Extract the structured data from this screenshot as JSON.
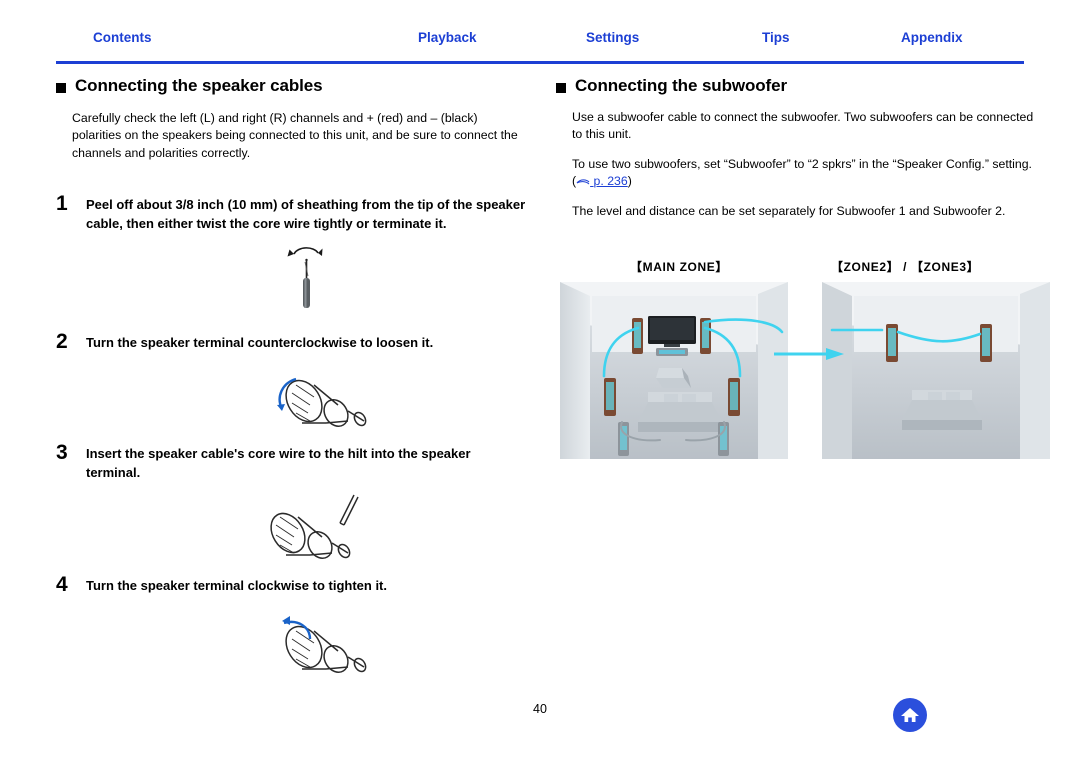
{
  "nav": {
    "items": [
      {
        "label": "Contents"
      },
      {
        "label": "Playback"
      },
      {
        "label": "Settings"
      },
      {
        "label": "Tips"
      },
      {
        "label": "Appendix"
      }
    ],
    "accent_color": "#1c3fd4"
  },
  "left": {
    "heading": "Connecting the speaker cables",
    "intro": "Carefully check the left (L) and right (R) channels and + (red) and – (black) polarities on the speakers being connected to this unit, and be sure to connect the channels and polarities correctly.",
    "steps": [
      {
        "number": "1",
        "text": "Peel off about 3/8 inch (10 mm) of sheathing from the tip of the speaker cable, then either twist the core wire tightly or terminate it.",
        "figure": "speaker-cable-twist-illustration"
      },
      {
        "number": "2",
        "text": "Turn the speaker terminal counterclockwise to loosen it.",
        "figure": "terminal-loosen-illustration"
      },
      {
        "number": "3",
        "text": "Insert the speaker cable's core wire to the hilt into the speaker terminal.",
        "figure": "insert-core-wire-illustration"
      },
      {
        "number": "4",
        "text": "Turn the speaker terminal clockwise to tighten it.",
        "figure": "terminal-tighten-illustration"
      }
    ]
  },
  "right": {
    "heading": "Connecting the subwoofer",
    "paragraph1": "Use a subwoofer cable to connect the subwoofer. Two subwoofers can be connected to this unit.",
    "paragraph2_before": "To use two subwoofers, set “Subwoofer” to “2 spkrs” in the “Speaker Config.” setting.  (",
    "paragraph2_link": "p. 236",
    "paragraph2_after": ")",
    "paragraph3": "The level and distance can be set separately for Subwoofer 1 and Subwoofer 2.",
    "zone_labels": {
      "main": "【MAIN ZONE】",
      "zone23": "【ZONE2】 / 【ZONE3】"
    },
    "figures": [
      {
        "name": "main-zone-room-illustration"
      },
      {
        "name": "zone2-zone3-room-illustration"
      }
    ]
  },
  "footer": {
    "page_number": "40",
    "home_button": "home-icon"
  }
}
